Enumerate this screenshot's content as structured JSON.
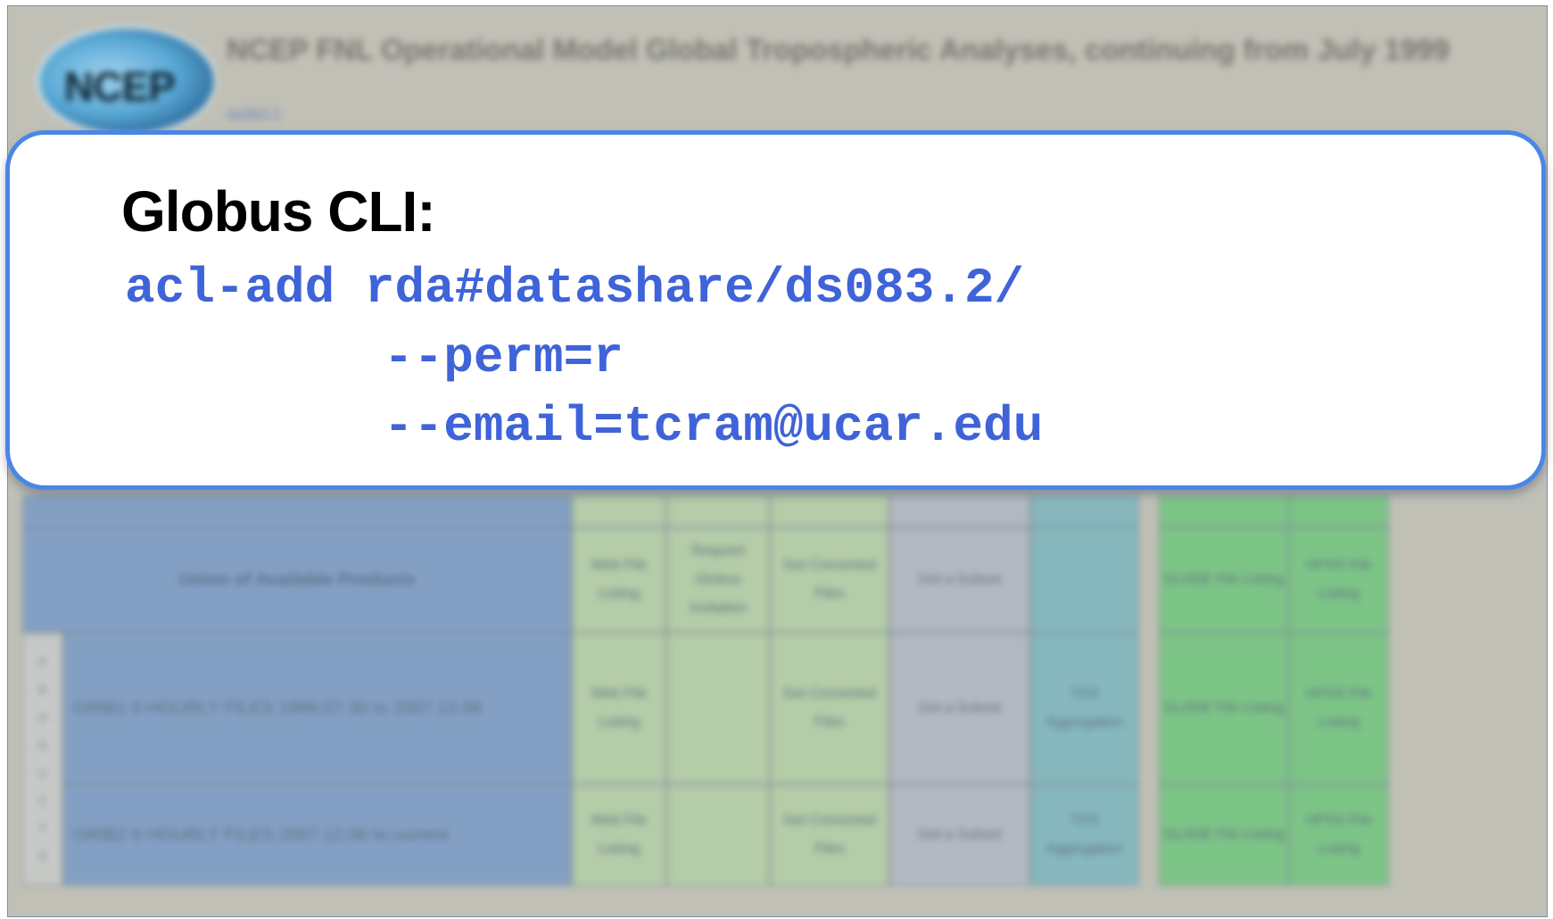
{
  "dataset_page": {
    "logo_text": "NCEP",
    "title": "NCEP FNL Operational Model Global Tropospheric Analyses, continuing from July 1999",
    "dataset_id": "ds083.2",
    "table": {
      "side_label": [
        "P",
        "R",
        "O",
        "D",
        "U",
        "C",
        "T",
        "S"
      ],
      "rows": [
        {
          "label": "Union of Available Products",
          "web_listing": "Web File Listing",
          "globus": "Request Globus Invitation",
          "converted": "Get Converted Files",
          "subset": "Get a Subset",
          "tds": "",
          "glade": "GLADE File Listing",
          "hpss": "HPSS File Listing"
        },
        {
          "label": "GRIB1 6 HOURLY FILES 1999.07.30 to 2007.12.06",
          "web_listing": "Web File Listing",
          "globus": "",
          "converted": "Get Converted Files",
          "subset": "Get a Subset",
          "tds": "TDS Aggregation",
          "glade": "GLADE File Listing",
          "hpss": "HPSS File Listing"
        },
        {
          "label": "GRIB2 6 HOURLY FILES 2007.12.06 to current",
          "web_listing": "Web File Listing",
          "globus": "",
          "converted": "Get Converted Files",
          "subset": "Get a Subset",
          "tds": "TDS Aggregation",
          "glade": "GLADE File Listing",
          "hpss": "HPSS File Listing"
        }
      ]
    }
  },
  "popup": {
    "title": "Globus CLI:",
    "command_line1": "acl-add rda#datashare/ds083.2/",
    "command_line2": "--perm=r",
    "command_line3": "--email=tcram@ucar.edu"
  },
  "colors": {
    "popup_border": "#4a86e8",
    "command_text": "#3f63d8",
    "background": "#c0c0b6"
  }
}
